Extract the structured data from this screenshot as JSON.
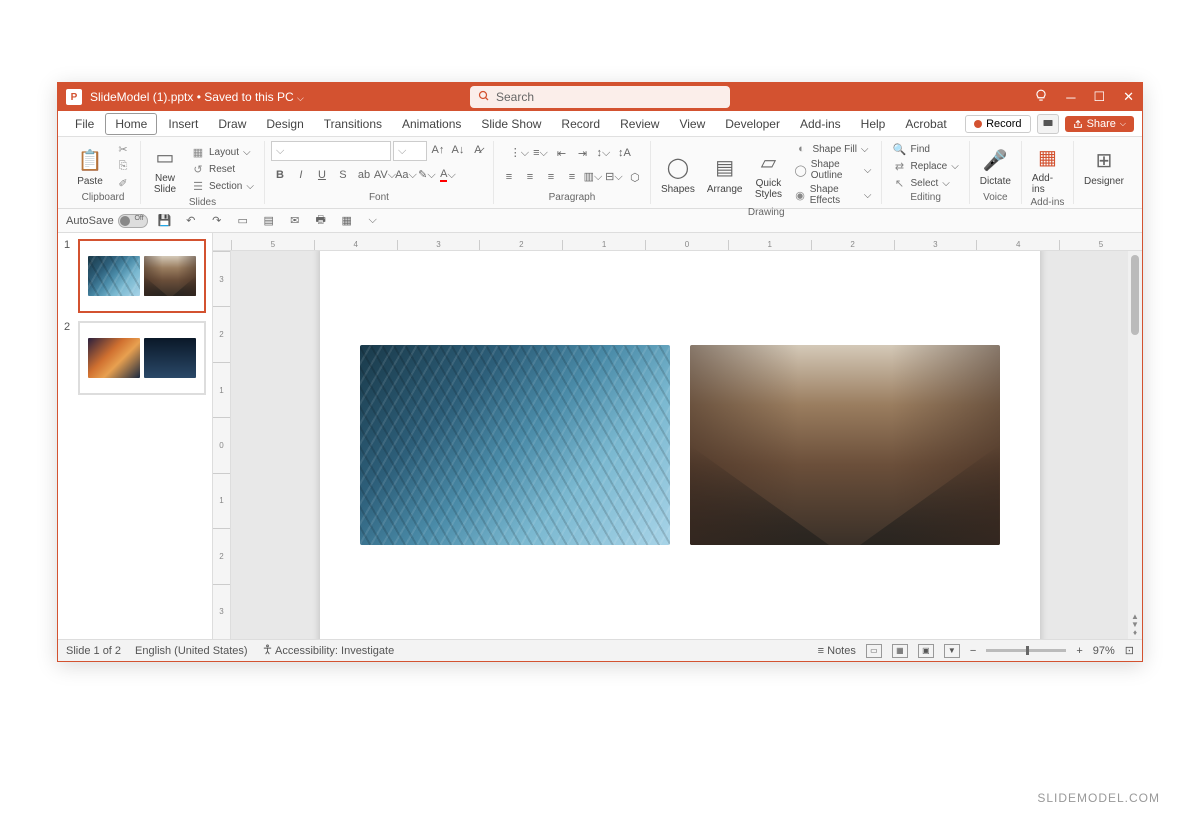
{
  "titlebar": {
    "filename": "SlideModel (1).pptx",
    "saved_status": "Saved to this PC",
    "search_placeholder": "Search"
  },
  "tabs": {
    "file": "File",
    "home": "Home",
    "insert": "Insert",
    "draw": "Draw",
    "design": "Design",
    "transitions": "Transitions",
    "animations": "Animations",
    "slideshow": "Slide Show",
    "record": "Record",
    "review": "Review",
    "view": "View",
    "developer": "Developer",
    "addins": "Add-ins",
    "help": "Help",
    "acrobat": "Acrobat"
  },
  "ribbon_right": {
    "record": "Record",
    "share": "Share"
  },
  "ribbon": {
    "clipboard": {
      "paste": "Paste",
      "label": "Clipboard"
    },
    "slides": {
      "new_slide": "New\nSlide",
      "layout": "Layout",
      "reset": "Reset",
      "section": "Section",
      "label": "Slides"
    },
    "font": {
      "label": "Font"
    },
    "paragraph": {
      "label": "Paragraph"
    },
    "drawing": {
      "shapes": "Shapes",
      "arrange": "Arrange",
      "quick_styles": "Quick\nStyles",
      "shape_fill": "Shape Fill",
      "shape_outline": "Shape Outline",
      "shape_effects": "Shape Effects",
      "label": "Drawing"
    },
    "editing": {
      "find": "Find",
      "replace": "Replace",
      "select": "Select",
      "label": "Editing"
    },
    "voice": {
      "dictate": "Dictate",
      "label": "Voice"
    },
    "addins_grp": {
      "addins": "Add-ins",
      "label": "Add-ins"
    },
    "designer_grp": {
      "designer": "Designer"
    }
  },
  "qat": {
    "autosave": "AutoSave",
    "off": "Off"
  },
  "slides": {
    "num1": "1",
    "num2": "2"
  },
  "ruler_marks": [
    "5",
    "4",
    "3",
    "2",
    "1",
    "0",
    "1",
    "2",
    "3",
    "4",
    "5"
  ],
  "ruler_v_marks": [
    "3",
    "2",
    "1",
    "0",
    "1",
    "2",
    "3"
  ],
  "status": {
    "slide_count": "Slide 1 of 2",
    "language": "English (United States)",
    "accessibility": "Accessibility: Investigate",
    "notes": "Notes",
    "zoom": "97%"
  },
  "watermark": "SLIDEMODEL.COM"
}
